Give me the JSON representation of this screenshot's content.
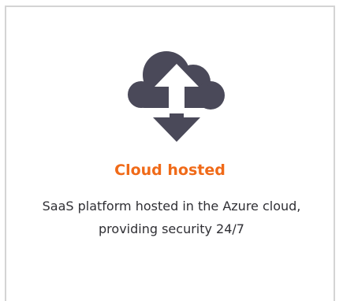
{
  "feature_card": {
    "icon": "cloud-upload-download-icon",
    "title": "Cloud hosted",
    "description": "SaaS platform hosted in the Azure cloud, providing security 24/7"
  },
  "colors": {
    "title": "#f06a18",
    "icon": "#4a4959",
    "text": "#2f2f34",
    "border": "#d4d4d4"
  }
}
